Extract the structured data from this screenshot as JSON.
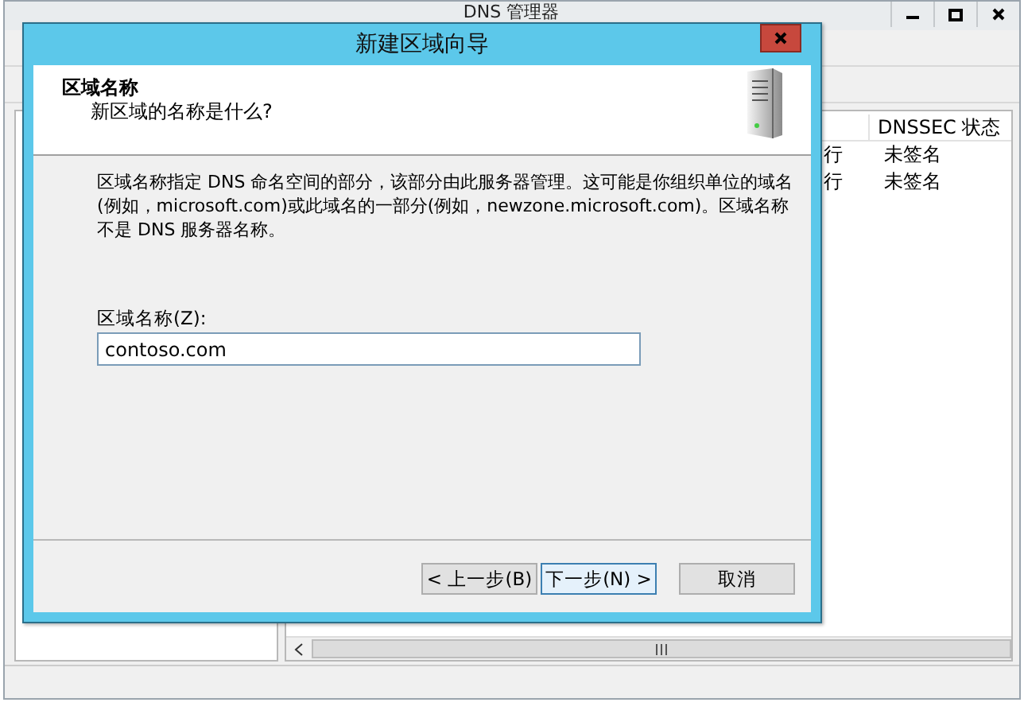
{
  "main_window": {
    "title": "DNS 管理器",
    "columns": [
      {
        "label": "DNSSEC 状态"
      }
    ],
    "rows": [
      {
        "column_1": "行",
        "dnssec_status": "未签名"
      },
      {
        "column_1": "行",
        "dnssec_status": "未签名"
      }
    ]
  },
  "dialog": {
    "title": "新建区域向导",
    "heading": "区域名称",
    "subheading": "新区域的名称是什么?",
    "description": "区域名称指定 DNS 命名空间的部分，该部分由此服务器管理。这可能是你组织单位的域名(例如，microsoft.com)或此域名的一部分(例如，newzone.microsoft.com)。区域名称不是 DNS 服务器名称。",
    "field": {
      "label": "区域名称(Z):",
      "value": "contoso.com"
    },
    "buttons": [
      {
        "label": "< 上一步(B)",
        "kind": "nav",
        "default": false
      },
      {
        "label": "下一步(N) >",
        "kind": "nav",
        "default": true
      },
      {
        "label": "取消",
        "kind": "cancel",
        "default": false
      }
    ]
  }
}
